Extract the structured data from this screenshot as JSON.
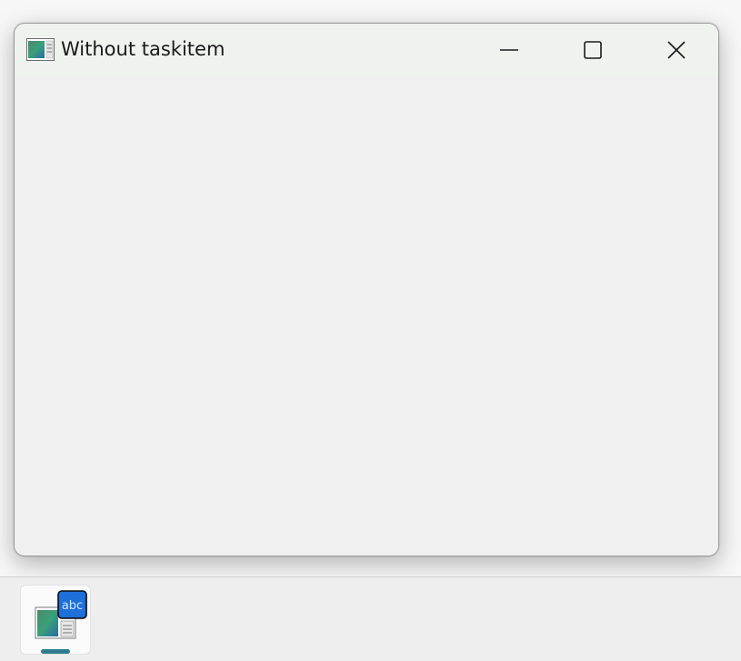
{
  "window": {
    "title": "Without taskitem",
    "icon": "app-window-icon",
    "controls": {
      "minimize_icon": "minimize-icon",
      "maximize_icon": "maximize-icon",
      "close_icon": "close-icon"
    }
  },
  "taskbar": {
    "items": [
      {
        "icon": "app-icon-with-abc-overlay",
        "overlay_text": "abc",
        "active": true
      }
    ]
  },
  "colors": {
    "titlebar": "#eef3ee",
    "client": "#f0f0f0",
    "taskbar": "#eeeeef",
    "indicator": "#2d7d8e",
    "overlay_badge": "#1e6fd9"
  }
}
